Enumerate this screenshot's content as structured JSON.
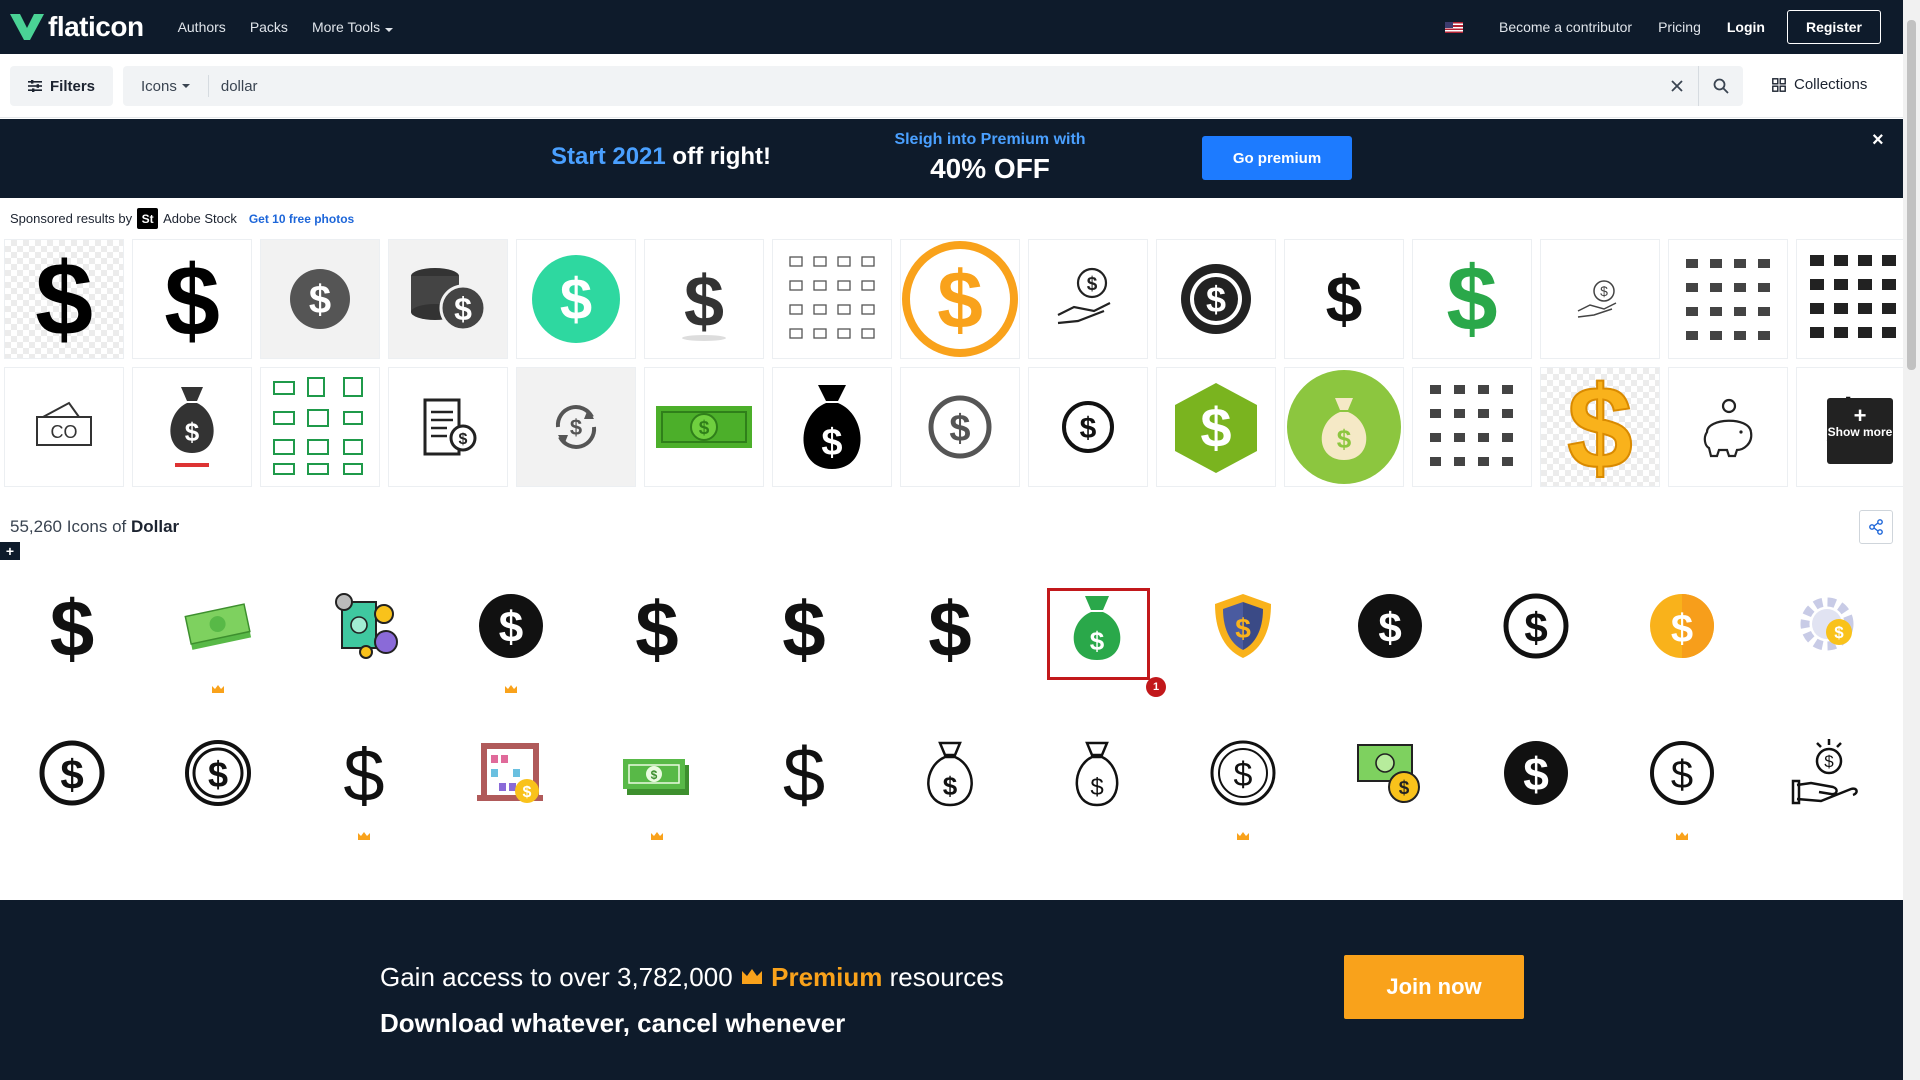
{
  "header": {
    "brand": "flaticon",
    "nav": [
      "Authors",
      "Packs",
      "More Tools"
    ],
    "contributor": "Become a contributor",
    "pricing": "Pricing",
    "login": "Login",
    "register": "Register"
  },
  "search": {
    "filters_label": "Filters",
    "type": "Icons",
    "query": "dollar",
    "collections_label": "Collections"
  },
  "promo": {
    "start_a": "Start 2021",
    "start_b": " off right!",
    "line1": "Sleigh into Premium with",
    "line2": "40% OFF",
    "button": "Go premium",
    "close": "×"
  },
  "sponsored": {
    "label": "Sponsored results by",
    "badge": "St",
    "brand": "Adobe Stock",
    "link": "Get 10 free photos",
    "show_more_plus": "+",
    "show_more": "Show more"
  },
  "results": {
    "count": "55,260",
    "mid": " Icons of ",
    "term": "Dollar",
    "add": "+",
    "selected_number": "1"
  },
  "footer": {
    "pre": "Gain access to over 3,782,000 ",
    "premium": "Premium",
    "post": " resources",
    "tagline": "Download whatever, cancel whenever",
    "button": "Join now"
  },
  "colors": {
    "navy": "#0e1b2b",
    "accent_blue": "#1d7bff",
    "premium_orange": "#f9a21b",
    "dollar_green": "#2aa84a",
    "highlight_red": "#c2181b"
  }
}
